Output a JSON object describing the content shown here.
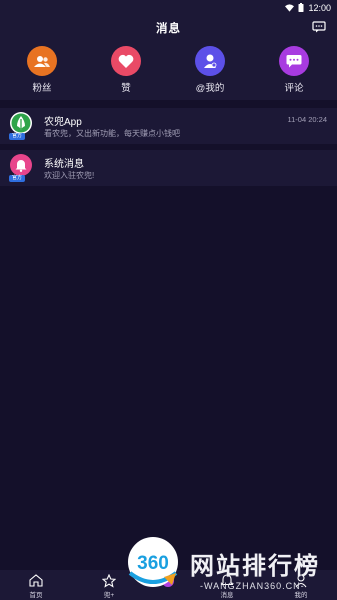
{
  "status_bar": {
    "time": "12:00"
  },
  "header": {
    "title": "消息",
    "settings_icon": "message-settings-icon"
  },
  "categories": [
    {
      "label": "粉丝",
      "icon": "fans-icon",
      "color": "#e87322"
    },
    {
      "label": "赞",
      "icon": "heart-icon",
      "color": "#e94a66"
    },
    {
      "label": "@我的",
      "icon": "mention-icon",
      "color": "#5c50e8"
    },
    {
      "label": "评论",
      "icon": "comment-icon",
      "color": "#a83be0"
    }
  ],
  "messages": [
    {
      "title": "农兜App",
      "preview": "看农兜，又出新功能，每天赚点小钱吧",
      "time": "11-04 20:24",
      "badge": "官方",
      "avatar_color": "#ffffff"
    },
    {
      "title": "系统消息",
      "preview": "欢迎入驻农兜!",
      "time": "",
      "badge": "官方",
      "avatar_color": "#e8458c"
    }
  ],
  "tabbar": [
    {
      "label": "首页",
      "icon": "home-icon"
    },
    {
      "label": "兜+",
      "icon": "star-icon"
    },
    {
      "label": "",
      "icon": "center-icon"
    },
    {
      "label": "消息",
      "icon": "bell-icon"
    },
    {
      "label": "我的",
      "icon": "person-icon"
    }
  ],
  "watermark": {
    "number": "360",
    "name": "网站排行榜",
    "sub": "-WANGZHAN360.CN-"
  }
}
